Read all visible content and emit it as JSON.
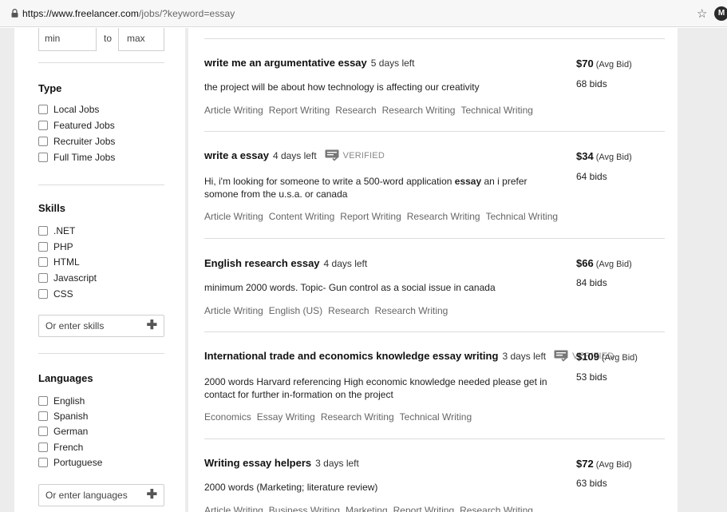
{
  "browser": {
    "url_host": "https://www.freelancer.com",
    "url_path": "/jobs/?keyword=essay",
    "profile_initial": "M"
  },
  "sidebar": {
    "range": {
      "min_placeholder": "min",
      "to_label": "to",
      "max_placeholder": "max"
    },
    "type": {
      "title": "Type",
      "options": [
        "Local Jobs",
        "Featured Jobs",
        "Recruiter Jobs",
        "Full Time Jobs"
      ]
    },
    "skills": {
      "title": "Skills",
      "options": [
        ".NET",
        "PHP",
        "HTML",
        "Javascript",
        "CSS"
      ],
      "input_placeholder": "Or enter skills"
    },
    "languages": {
      "title": "Languages",
      "options": [
        "English",
        "Spanish",
        "German",
        "French",
        "Portuguese"
      ],
      "input_placeholder": "Or enter languages"
    }
  },
  "jobs": [
    {
      "title": "write me an argumentative essay",
      "days_left": "5 days left",
      "verified": false,
      "description_before": "the project will be about how technology is affecting our creativity",
      "description_bold": "",
      "description_after": "",
      "tags": [
        "Article Writing",
        "Report Writing",
        "Research",
        "Research Writing",
        "Technical Writing"
      ],
      "price": "$70",
      "price_suffix": "(Avg Bid)",
      "bids": "68 bids"
    },
    {
      "title": "write a essay",
      "days_left": "4 days left",
      "verified": true,
      "verified_label": "VERIFIED",
      "description_before": "Hi, i'm looking for someone to write a 500-word application ",
      "description_bold": "essay",
      "description_after": " an i prefer somone from the u.s.a. or canada",
      "tags": [
        "Article Writing",
        "Content Writing",
        "Report Writing",
        "Research Writing",
        "Technical Writing"
      ],
      "price": "$34",
      "price_suffix": "(Avg Bid)",
      "bids": "64 bids"
    },
    {
      "title": "English research essay",
      "days_left": "4 days left",
      "verified": false,
      "description_before": "minimum 2000 words. Topic- Gun control as a social issue in canada",
      "description_bold": "",
      "description_after": "",
      "tags": [
        "Article Writing",
        "English (US)",
        "Research",
        "Research Writing"
      ],
      "price": "$66",
      "price_suffix": "(Avg Bid)",
      "bids": "84 bids"
    },
    {
      "title": "International trade and economics knowledge essay writing",
      "days_left": "3 days left",
      "verified": true,
      "verified_label": "VERIFIED",
      "description_before": "2000 words Harvard referencing High economic knowledge needed please get in contact for further in-formation on the project",
      "description_bold": "",
      "description_after": "",
      "tags": [
        "Economics",
        "Essay Writing",
        "Research Writing",
        "Technical Writing"
      ],
      "price": "$109",
      "price_suffix": "(Avg Bid)",
      "bids": "53 bids"
    },
    {
      "title": "Writing essay helpers",
      "days_left": "3 days left",
      "verified": false,
      "description_before": "2000 words (Marketing; literature review)",
      "description_bold": "",
      "description_after": "",
      "tags": [
        "Article Writing",
        "Business Writing",
        "Marketing",
        "Report Writing",
        "Research Writing"
      ],
      "price": "$72",
      "price_suffix": "(Avg Bid)",
      "bids": "63 bids"
    }
  ],
  "icons": {
    "lock": "lock-icon",
    "star": "star-icon",
    "plus": "plus-icon",
    "verified": "verified-badge-icon"
  }
}
